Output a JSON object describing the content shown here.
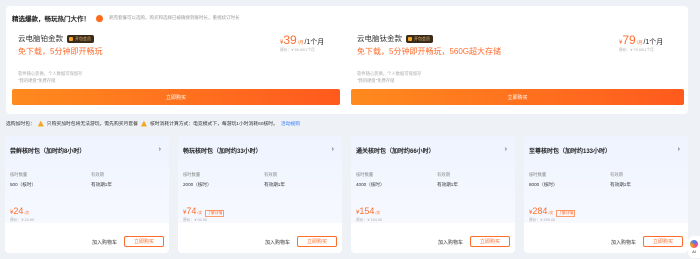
{
  "promo": {
    "title": "精选爆款，畅玩热门大作！",
    "hint": "耗完套餐可以选购，购买和选择已被确保到账时长，重视续订时长"
  },
  "plans": [
    {
      "name": "云电脑铂金款",
      "badge": "开包会员",
      "slogan": "免下载，5分钟即开畅玩",
      "note1": "软件随心装换，个人数据可保留存",
      "note2": "\"我的硬盘\"免费存储",
      "currency": "¥",
      "price": "39",
      "unit": "/月",
      "per": "/1个月",
      "original": "原价：¥ 59.00/1个月",
      "cta": "立即购买"
    },
    {
      "name": "云电脑钛金款",
      "badge": "开包会员",
      "slogan": "免下载，5分钟即开畅玩，560G超大存储",
      "note1": "软件随心装换，个人数据可保留存",
      "note2": "\"我的硬盘\"免费存储",
      "currency": "¥",
      "price": "79",
      "unit": "/月",
      "per": "/1个月",
      "original": "原价：¥ 79.00/1个月",
      "cta": "立即购买"
    }
  ],
  "notice": {
    "lead": "选购加时包：",
    "warn1": "只购买加时包将无法游玩，需先购买月套餐",
    "warn2": "核时消耗计算方式：电竞模式下，每游玩1小时消耗60核时。",
    "link": "活动规则"
  },
  "packs": [
    {
      "title": "尝鲜核时包（加时约8小时）",
      "qty_label": "核时数量",
      "qty": "500（核时）",
      "valid_label": "有效期",
      "valid": "有效期1年",
      "currency": "¥",
      "price": "24",
      "unit": "/次",
      "discount": "",
      "original": "原价：¥ 24.90",
      "cart": "加入购物车",
      "buy": "立即购买"
    },
    {
      "title": "畅玩核时包（加时约33小时）",
      "qty_label": "核时数量",
      "qty": "2000（核时）",
      "valid_label": "有效期",
      "valid": "有效期1年",
      "currency": "¥",
      "price": "74",
      "unit": "/次",
      "discount": "了解详情",
      "original": "原价：¥ 94.00",
      "cart": "加入购物车",
      "buy": "立即购买"
    },
    {
      "title": "通关核时包（加时约66小时）",
      "qty_label": "核时数量",
      "qty": "4000（核时）",
      "valid_label": "有效期",
      "valid": "有效期1年",
      "currency": "¥",
      "price": "154",
      "unit": "/次",
      "discount": "",
      "original": "原价：¥ 154.00",
      "cart": "加入购物车",
      "buy": "立即购买"
    },
    {
      "title": "至尊核时包（加时约133小时）",
      "qty_label": "核时数量",
      "qty": "8000（核时）",
      "valid_label": "有效期",
      "valid": "有效期1年",
      "currency": "¥",
      "price": "284",
      "unit": "/次",
      "discount": "了解详情",
      "original": "原价：¥ 299.00",
      "cart": "加入购物车",
      "buy": "立即购买"
    }
  ],
  "side_widget": {
    "label": "AI"
  },
  "colors": {
    "accent": "#ff6d2d",
    "link": "#2b7cff",
    "warning": "#f5a623"
  },
  "icons": [
    "fire-icon",
    "vip-badge-icon",
    "warning-icon",
    "chevron-right-icon",
    "ai-assistant-icon"
  ]
}
